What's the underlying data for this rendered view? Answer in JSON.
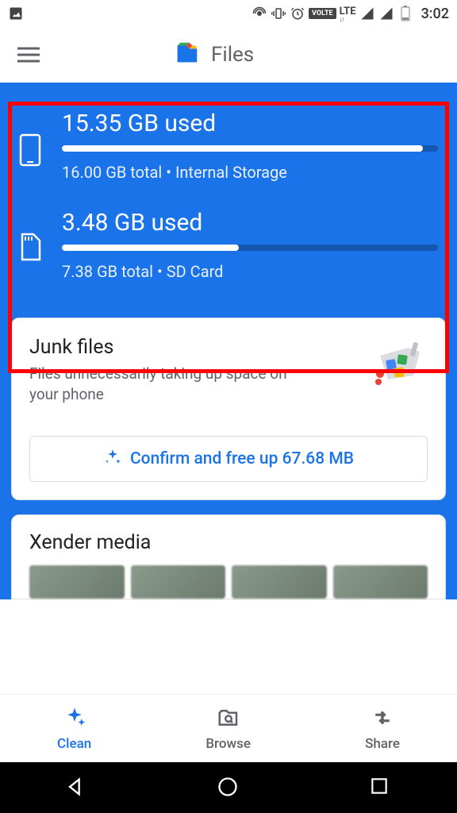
{
  "statusBar": {
    "time": "3:02"
  },
  "header": {
    "title": "Files"
  },
  "storage": {
    "internal": {
      "used": "15.35 GB used",
      "total": "16.00 GB total • Internal Storage",
      "percent": 96
    },
    "sdcard": {
      "used": "3.48 GB used",
      "total": "7.38 GB total • SD Card",
      "percent": 47
    }
  },
  "junkCard": {
    "title": "Junk files",
    "subtitle": "Files unnecessarily taking up space on your phone",
    "action": "Confirm and free up 67.68 MB"
  },
  "mediaCard": {
    "title": "Xender media"
  },
  "nav": {
    "clean": "Clean",
    "browse": "Browse",
    "share": "Share"
  }
}
